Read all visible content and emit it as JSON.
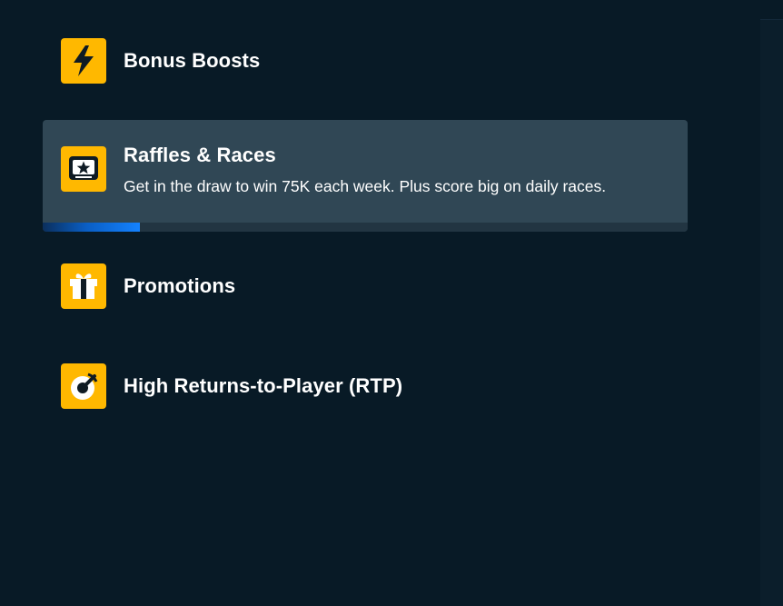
{
  "promotions_menu": {
    "items": [
      {
        "title": "Bonus Boosts",
        "description": "",
        "icon": "lightning-bolt-icon",
        "active": false
      },
      {
        "title": "Raffles & Races",
        "description": "Get in the draw to win 75K each week. Plus score big on daily races.",
        "icon": "ticket-star-icon",
        "active": true,
        "progress": 0.15
      },
      {
        "title": "Promotions",
        "description": "",
        "icon": "gift-icon",
        "active": false
      },
      {
        "title": "High Returns-to-Player (RTP)",
        "description": "",
        "icon": "gauge-icon",
        "active": false
      }
    ]
  },
  "colors": {
    "background": "#081a26",
    "active_card": "#304755",
    "icon_background": "#ffb800",
    "icon_glyph": "#0f1b24",
    "progress_accent": "#1482ff",
    "text": "#ffffff"
  }
}
